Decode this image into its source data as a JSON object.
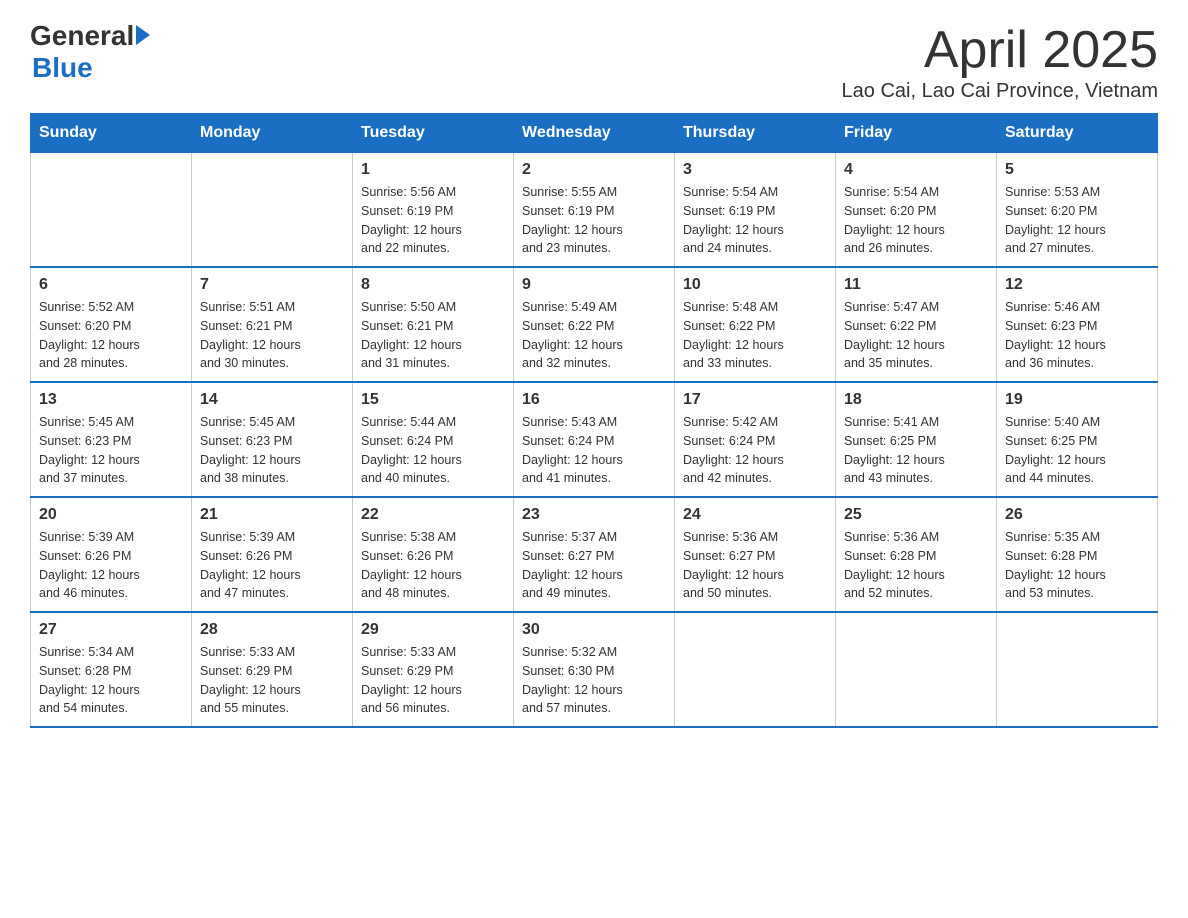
{
  "header": {
    "logo_general": "General",
    "logo_blue": "Blue",
    "title": "April 2025",
    "subtitle": "Lao Cai, Lao Cai Province, Vietnam"
  },
  "calendar": {
    "columns": [
      "Sunday",
      "Monday",
      "Tuesday",
      "Wednesday",
      "Thursday",
      "Friday",
      "Saturday"
    ],
    "weeks": [
      [
        {
          "day": "",
          "info": ""
        },
        {
          "day": "",
          "info": ""
        },
        {
          "day": "1",
          "info": "Sunrise: 5:56 AM\nSunset: 6:19 PM\nDaylight: 12 hours\nand 22 minutes."
        },
        {
          "day": "2",
          "info": "Sunrise: 5:55 AM\nSunset: 6:19 PM\nDaylight: 12 hours\nand 23 minutes."
        },
        {
          "day": "3",
          "info": "Sunrise: 5:54 AM\nSunset: 6:19 PM\nDaylight: 12 hours\nand 24 minutes."
        },
        {
          "day": "4",
          "info": "Sunrise: 5:54 AM\nSunset: 6:20 PM\nDaylight: 12 hours\nand 26 minutes."
        },
        {
          "day": "5",
          "info": "Sunrise: 5:53 AM\nSunset: 6:20 PM\nDaylight: 12 hours\nand 27 minutes."
        }
      ],
      [
        {
          "day": "6",
          "info": "Sunrise: 5:52 AM\nSunset: 6:20 PM\nDaylight: 12 hours\nand 28 minutes."
        },
        {
          "day": "7",
          "info": "Sunrise: 5:51 AM\nSunset: 6:21 PM\nDaylight: 12 hours\nand 30 minutes."
        },
        {
          "day": "8",
          "info": "Sunrise: 5:50 AM\nSunset: 6:21 PM\nDaylight: 12 hours\nand 31 minutes."
        },
        {
          "day": "9",
          "info": "Sunrise: 5:49 AM\nSunset: 6:22 PM\nDaylight: 12 hours\nand 32 minutes."
        },
        {
          "day": "10",
          "info": "Sunrise: 5:48 AM\nSunset: 6:22 PM\nDaylight: 12 hours\nand 33 minutes."
        },
        {
          "day": "11",
          "info": "Sunrise: 5:47 AM\nSunset: 6:22 PM\nDaylight: 12 hours\nand 35 minutes."
        },
        {
          "day": "12",
          "info": "Sunrise: 5:46 AM\nSunset: 6:23 PM\nDaylight: 12 hours\nand 36 minutes."
        }
      ],
      [
        {
          "day": "13",
          "info": "Sunrise: 5:45 AM\nSunset: 6:23 PM\nDaylight: 12 hours\nand 37 minutes."
        },
        {
          "day": "14",
          "info": "Sunrise: 5:45 AM\nSunset: 6:23 PM\nDaylight: 12 hours\nand 38 minutes."
        },
        {
          "day": "15",
          "info": "Sunrise: 5:44 AM\nSunset: 6:24 PM\nDaylight: 12 hours\nand 40 minutes."
        },
        {
          "day": "16",
          "info": "Sunrise: 5:43 AM\nSunset: 6:24 PM\nDaylight: 12 hours\nand 41 minutes."
        },
        {
          "day": "17",
          "info": "Sunrise: 5:42 AM\nSunset: 6:24 PM\nDaylight: 12 hours\nand 42 minutes."
        },
        {
          "day": "18",
          "info": "Sunrise: 5:41 AM\nSunset: 6:25 PM\nDaylight: 12 hours\nand 43 minutes."
        },
        {
          "day": "19",
          "info": "Sunrise: 5:40 AM\nSunset: 6:25 PM\nDaylight: 12 hours\nand 44 minutes."
        }
      ],
      [
        {
          "day": "20",
          "info": "Sunrise: 5:39 AM\nSunset: 6:26 PM\nDaylight: 12 hours\nand 46 minutes."
        },
        {
          "day": "21",
          "info": "Sunrise: 5:39 AM\nSunset: 6:26 PM\nDaylight: 12 hours\nand 47 minutes."
        },
        {
          "day": "22",
          "info": "Sunrise: 5:38 AM\nSunset: 6:26 PM\nDaylight: 12 hours\nand 48 minutes."
        },
        {
          "day": "23",
          "info": "Sunrise: 5:37 AM\nSunset: 6:27 PM\nDaylight: 12 hours\nand 49 minutes."
        },
        {
          "day": "24",
          "info": "Sunrise: 5:36 AM\nSunset: 6:27 PM\nDaylight: 12 hours\nand 50 minutes."
        },
        {
          "day": "25",
          "info": "Sunrise: 5:36 AM\nSunset: 6:28 PM\nDaylight: 12 hours\nand 52 minutes."
        },
        {
          "day": "26",
          "info": "Sunrise: 5:35 AM\nSunset: 6:28 PM\nDaylight: 12 hours\nand 53 minutes."
        }
      ],
      [
        {
          "day": "27",
          "info": "Sunrise: 5:34 AM\nSunset: 6:28 PM\nDaylight: 12 hours\nand 54 minutes."
        },
        {
          "day": "28",
          "info": "Sunrise: 5:33 AM\nSunset: 6:29 PM\nDaylight: 12 hours\nand 55 minutes."
        },
        {
          "day": "29",
          "info": "Sunrise: 5:33 AM\nSunset: 6:29 PM\nDaylight: 12 hours\nand 56 minutes."
        },
        {
          "day": "30",
          "info": "Sunrise: 5:32 AM\nSunset: 6:30 PM\nDaylight: 12 hours\nand 57 minutes."
        },
        {
          "day": "",
          "info": ""
        },
        {
          "day": "",
          "info": ""
        },
        {
          "day": "",
          "info": ""
        }
      ]
    ]
  }
}
